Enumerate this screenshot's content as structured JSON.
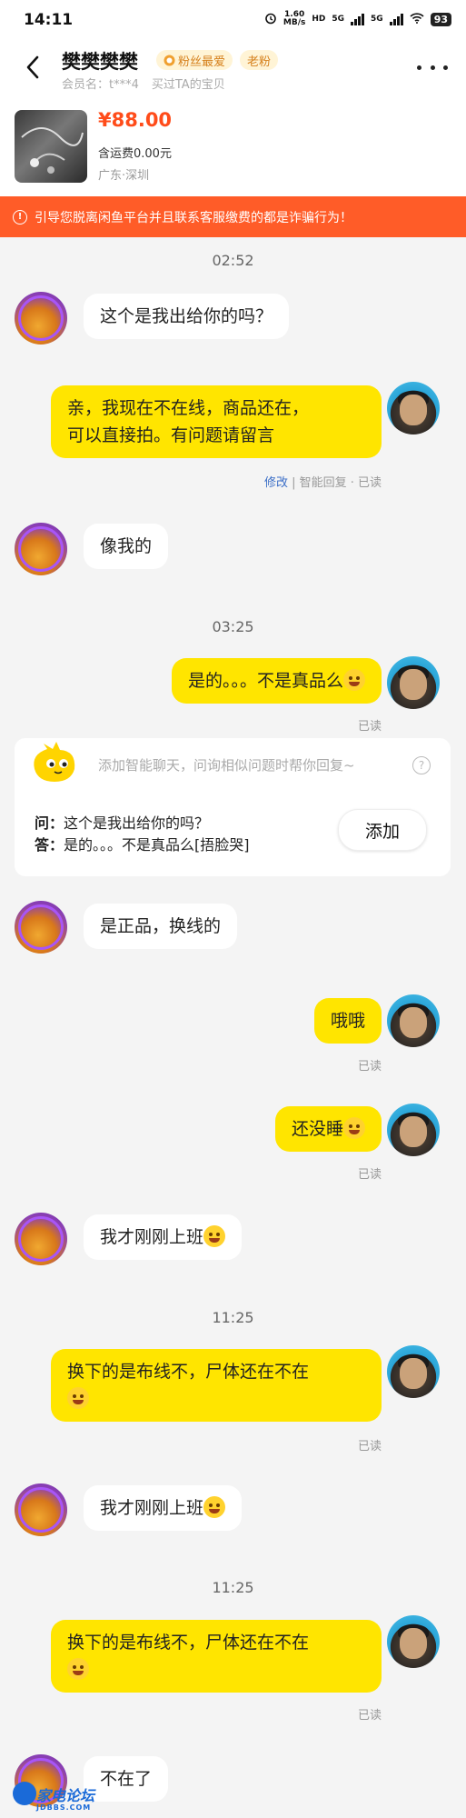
{
  "status_bar": {
    "time": "14:11",
    "speed_value": "1.60",
    "speed_unit": "MB/s",
    "network_a": "5G",
    "network_b": "5G",
    "battery": "93"
  },
  "header": {
    "title": "樊樊樊樊",
    "fan_badge": "粉丝最爱",
    "old_fan_badge": "老粉",
    "member_label": "会员名：t***4",
    "bought_label": "买过TA的宝贝"
  },
  "product": {
    "price": "¥88.00",
    "shipping": "含运费0.00元",
    "location": "广东·深圳"
  },
  "warning": "引导您脱离闲鱼平台并且联系客服缴费的都是诈骗行为！",
  "timestamps": [
    "02:52",
    "03:25",
    "11:25",
    "11:25"
  ],
  "messages": [
    {
      "text": "这个是我出给你的吗？"
    },
    {
      "text": "亲，我现在不在线，商品还在，",
      "text2": "可以直接拍。有问题请留言",
      "edit": "修改",
      "meta": " | 智能回复 · 已读"
    },
    {
      "text": "像我的"
    },
    {
      "text": "是的。。。不是真品么",
      "meta": "已读"
    },
    {
      "text": "是正品，换线的"
    },
    {
      "text": "哦哦",
      "meta": "已读"
    },
    {
      "text": "还没睡",
      "meta": "已读"
    },
    {
      "text": "我才刚刚上班"
    },
    {
      "text": "换下的是布线不，尸体还在不在",
      "meta": "已读"
    },
    {
      "text": "我才刚刚上班"
    },
    {
      "text": "换下的是布线不，尸体还在不在",
      "meta": "已读"
    },
    {
      "text": "不在了"
    }
  ],
  "smart_card": {
    "hint": "添加智能聊天，问询相似问题时帮你回复~",
    "q_label": "问：",
    "q_text": "这个是我出给你的吗？",
    "a_label": "答：",
    "a_text": "是的。。。不是真品么[捂脸哭]",
    "add_button": "添加"
  },
  "watermark": {
    "name": "家电论坛",
    "site": "JDBBS.COM"
  },
  "colors": {
    "accent": "#ffe500",
    "warning": "#ff5c28",
    "price": "#ff4c1a",
    "link": "#3b6ec7"
  }
}
